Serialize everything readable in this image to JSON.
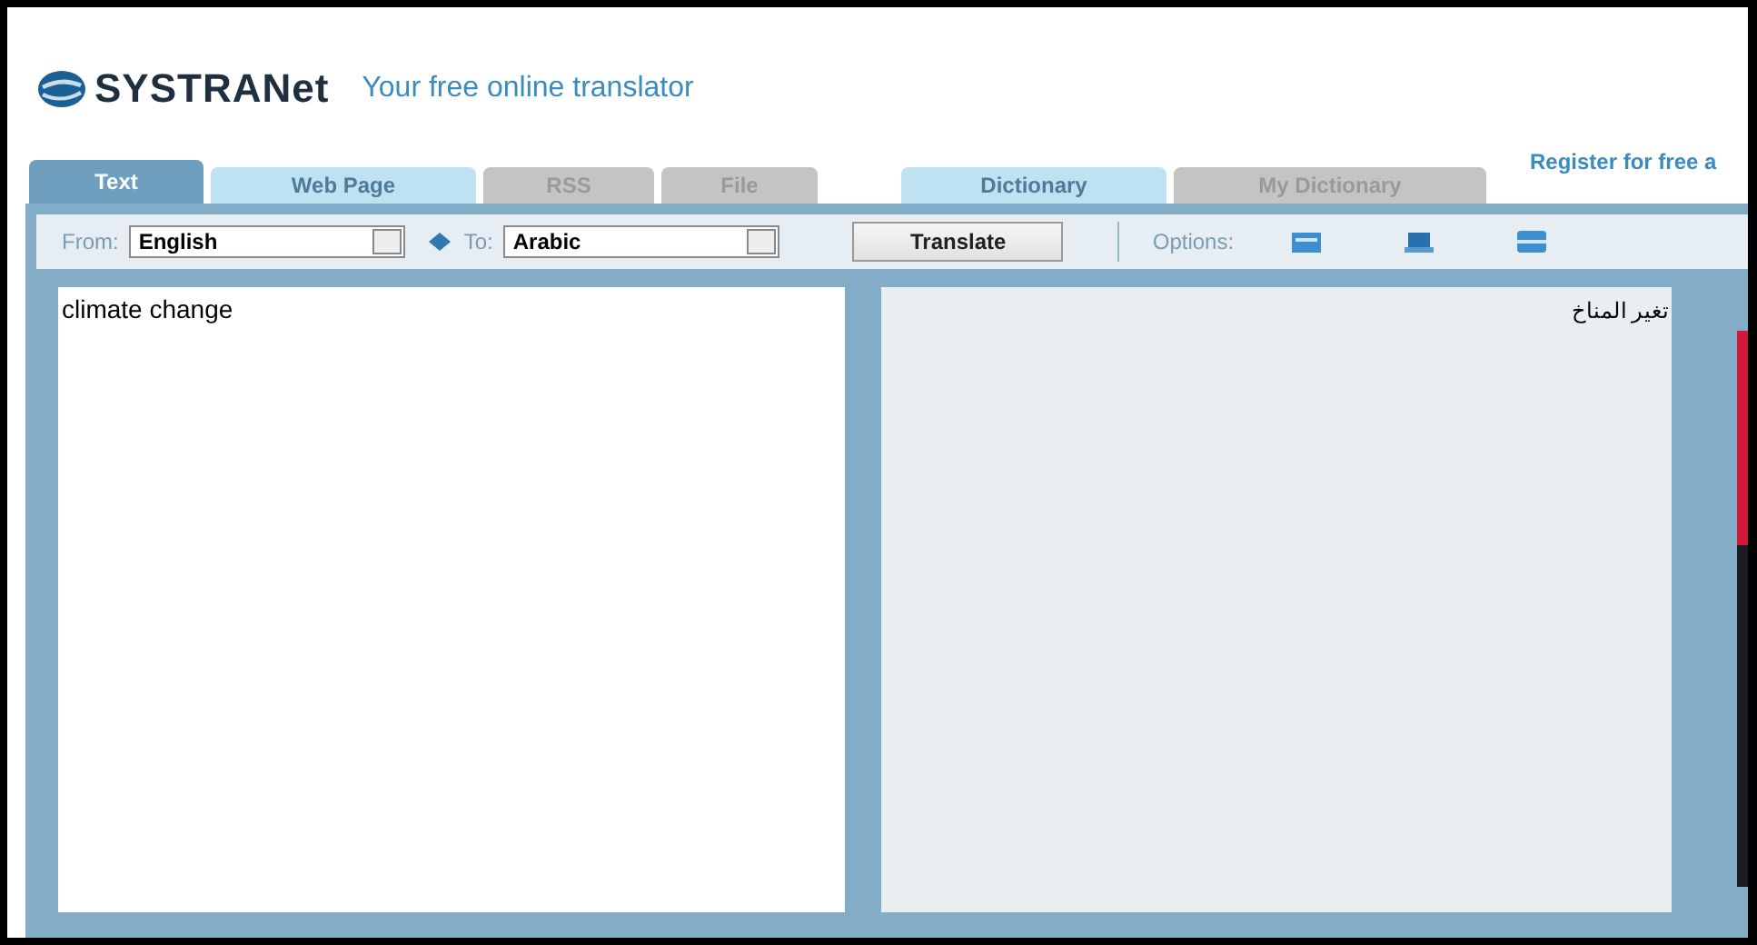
{
  "header": {
    "logo": "SYSTRANet",
    "tagline": "Your free online translator",
    "register_link": "Register for free a"
  },
  "tabs": [
    {
      "label": "Text",
      "selected": true,
      "disabled": false
    },
    {
      "label": "Web Page",
      "selected": false,
      "disabled": false
    },
    {
      "label": "RSS",
      "selected": false,
      "disabled": true
    },
    {
      "label": "File",
      "selected": false,
      "disabled": true
    }
  ],
  "dictionary_tabs": [
    {
      "label": "Dictionary",
      "selected": false,
      "disabled": false
    },
    {
      "label": "My Dictionary",
      "selected": false,
      "disabled": true
    }
  ],
  "toolbar": {
    "from_label": "From:",
    "from_value": "English",
    "to_label": "To:",
    "to_value": "Arabic",
    "translate_button": "Translate",
    "options_label": "Options:"
  },
  "source_text": "climate change",
  "translation": "تغير المناخ"
}
